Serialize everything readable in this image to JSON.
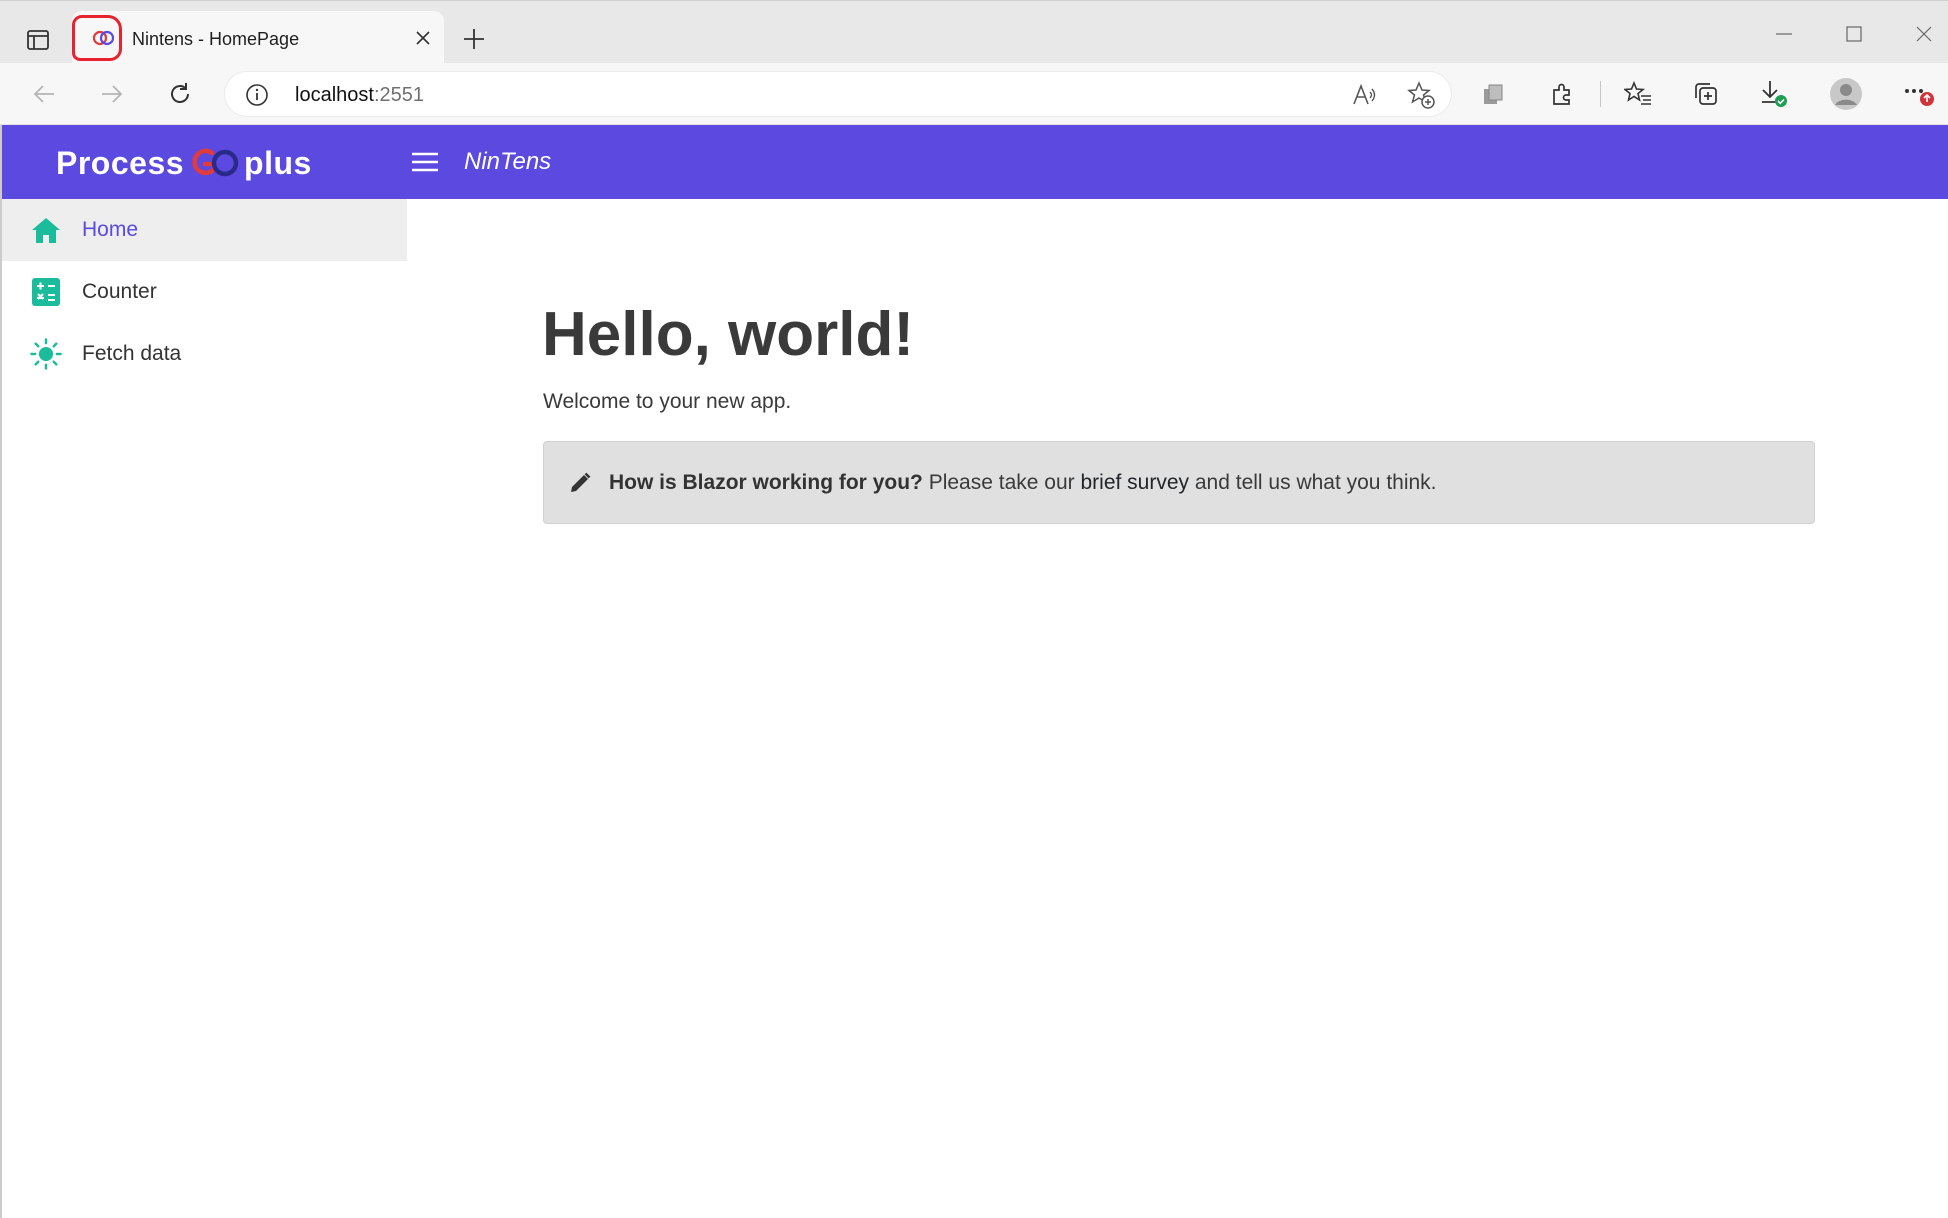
{
  "browser": {
    "tab": {
      "title": "Nintens - HomePage"
    },
    "address": {
      "host": "localhost",
      "port": ":2551"
    }
  },
  "app": {
    "brand": {
      "logo_left": "Process",
      "logo_right": "plus"
    },
    "title": "NinTens",
    "accent_color": "#5b49e0",
    "icon_color": "#1abc9c"
  },
  "sidebar": {
    "items": [
      {
        "label": "Home",
        "icon": "home-icon",
        "active": true
      },
      {
        "label": "Counter",
        "icon": "calculator-icon",
        "active": false
      },
      {
        "label": "Fetch data",
        "icon": "sun-icon",
        "active": false
      }
    ]
  },
  "main": {
    "heading": "Hello, world!",
    "welcome": "Welcome to your new app.",
    "survey": {
      "question": "How is Blazor working for you?",
      "prefix": "Please take our",
      "link": "brief survey",
      "suffix": "and tell us what you think."
    }
  }
}
